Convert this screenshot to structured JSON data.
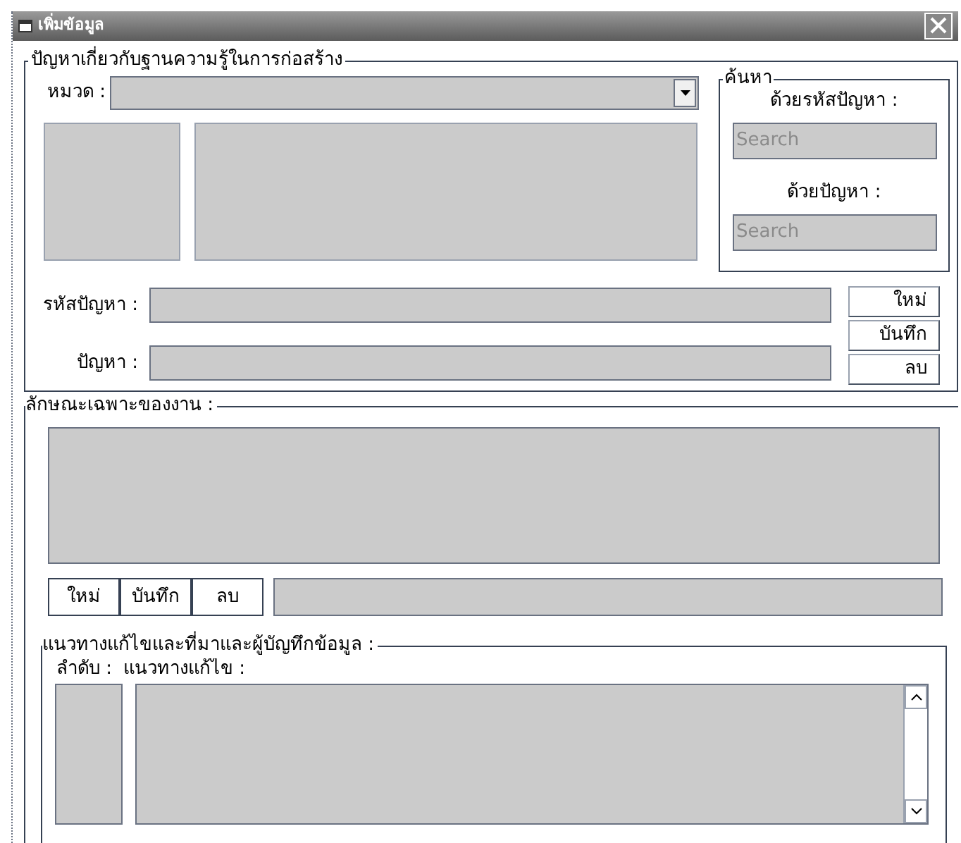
{
  "window": {
    "title": "เพิ่มข้อมูล"
  },
  "problem_group": {
    "title": "ปัญหาเกี่ยวกับฐานความรู้ในการก่อสร้าง",
    "category": {
      "label": "หมวด :"
    },
    "search": {
      "title": "ค้นหา",
      "fields": [
        {
          "label": "ด้วยรหัสปัญหา :",
          "placeholder": "Search"
        },
        {
          "label": "ด้วยปัญหา :",
          "placeholder": "Search"
        }
      ]
    },
    "fields": [
      {
        "label": "รหัสปัญหา :"
      },
      {
        "label": "ปัญหา :"
      }
    ],
    "buttons": [
      "ใหม่",
      "บันทึก",
      "ลบ"
    ]
  },
  "spec_group": {
    "title": "ลักษณะเฉพาะของงาน :",
    "buttons": [
      "ใหม่",
      "บันทึก",
      "ลบ"
    ]
  },
  "solution_group": {
    "title": "แนวทางแก้ไขและที่มาและผู้บัญทึกข้อมูล :",
    "columns": [
      "ลำดับ :",
      "แนวทางแก้ไข :"
    ]
  }
}
